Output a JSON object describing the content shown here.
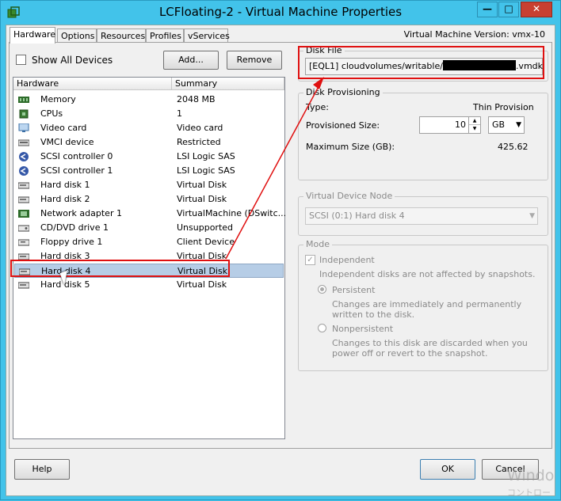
{
  "window": {
    "title": "LCFloating-2 - Virtual Machine Properties",
    "minimize_label": "—",
    "maximize_label": "□",
    "close_label": "✕"
  },
  "tabs": [
    "Hardware",
    "Options",
    "Resources",
    "Profiles",
    "vServices"
  ],
  "vm_version": "Virtual Machine Version: vmx-10",
  "show_all_devices_label": "Show All Devices",
  "add_button": "Add...",
  "remove_button": "Remove",
  "list": {
    "col_hardware": "Hardware",
    "col_summary": "Summary",
    "rows": [
      {
        "name": "Memory",
        "summary": "2048 MB",
        "icon": "memory-icon"
      },
      {
        "name": "CPUs",
        "summary": "1",
        "icon": "cpu-icon"
      },
      {
        "name": "Video card",
        "summary": "Video card",
        "icon": "monitor-icon"
      },
      {
        "name": "VMCI device",
        "summary": "Restricted",
        "icon": "device-icon"
      },
      {
        "name": "SCSI controller 0",
        "summary": "LSI Logic SAS",
        "icon": "scsi-icon"
      },
      {
        "name": "SCSI controller 1",
        "summary": "LSI Logic SAS",
        "icon": "scsi-icon"
      },
      {
        "name": "Hard disk 1",
        "summary": "Virtual Disk",
        "icon": "disk-icon"
      },
      {
        "name": "Hard disk 2",
        "summary": "Virtual Disk",
        "icon": "disk-icon"
      },
      {
        "name": "Network adapter 1",
        "summary": "VirtualMachine (DSwitc...",
        "icon": "network-icon"
      },
      {
        "name": "CD/DVD drive 1",
        "summary": "Unsupported",
        "icon": "cdrom-icon"
      },
      {
        "name": "Floppy drive 1",
        "summary": "Client Device",
        "icon": "floppy-icon"
      },
      {
        "name": "Hard disk 3",
        "summary": "Virtual Disk",
        "icon": "disk-icon"
      },
      {
        "name": "Hard disk 4",
        "summary": "Virtual Disk",
        "icon": "disk-icon"
      },
      {
        "name": "Hard disk 5",
        "summary": "Virtual Disk",
        "icon": "disk-icon"
      }
    ],
    "selected_index": 12
  },
  "disk_file": {
    "label": "Disk File",
    "prefix": "[EQL1] cloudvolumes/writable/",
    "suffix": ".vmdk"
  },
  "provisioning": {
    "label": "Disk Provisioning",
    "type_label": "Type:",
    "type_value": "Thin Provision",
    "size_label": "Provisioned Size:",
    "size_value": "10",
    "size_unit": "GB",
    "max_label": "Maximum Size (GB):",
    "max_value": "425.62"
  },
  "vdn": {
    "label": "Virtual Device Node",
    "value": "SCSI (0:1) Hard disk 4"
  },
  "mode": {
    "label": "Mode",
    "independent_label": "Independent",
    "independent_desc": "Independent disks are not affected by snapshots.",
    "persistent_label": "Persistent",
    "persistent_desc": "Changes are immediately and permanently written to the disk.",
    "nonpersistent_label": "Nonpersistent",
    "nonpersistent_desc": "Changes to this disk are discarded when you power off or revert to the snapshot."
  },
  "footer": {
    "help": "Help",
    "ok": "OK",
    "cancel": "Cancel",
    "watermark_1": "Windo",
    "watermark_2": "コントロー"
  },
  "colors": {
    "annotation": "#e01010",
    "titlebar": "#42c3ea",
    "selection": "#b6cde6"
  }
}
